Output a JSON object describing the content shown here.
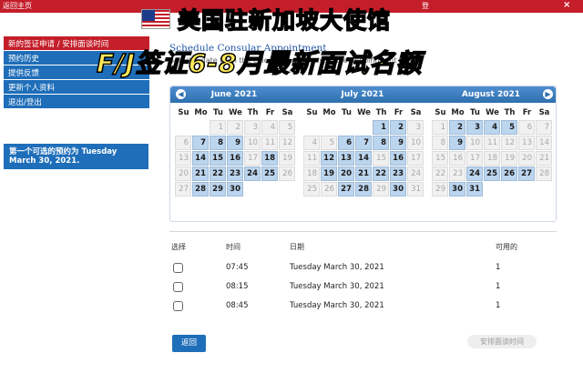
{
  "topbar": {
    "back_label": "返回主页",
    "right_text": "登",
    "close_glyph": "×"
  },
  "sidebar": {
    "items": [
      {
        "label": "新的签证申请 / 安排面谈时间"
      },
      {
        "label": "预约历史"
      },
      {
        "label": "提供反馈"
      },
      {
        "label": "更新个人资料"
      },
      {
        "label": "退出/登出"
      }
    ],
    "next_appointment_line1": "第一个可选的预约为 Tuesday",
    "next_appointment_line2": "March 30, 2021."
  },
  "page": {
    "title": "Schedule Consular Appointment",
    "subtitle": "Select a date from the calendar and an available appointment time."
  },
  "calendar": {
    "prev_glyph": "◀",
    "next_glyph": "▶",
    "weekdays": [
      "Su",
      "Mo",
      "Tu",
      "We",
      "Th",
      "Fr",
      "Sa"
    ],
    "months": [
      {
        "name": "June 2021",
        "weeks": [
          [
            "",
            "",
            "1",
            "2",
            "3",
            "4",
            "5"
          ],
          [
            "6",
            "7",
            "8",
            "9",
            "10",
            "11",
            "12"
          ],
          [
            "13",
            "14",
            "15",
            "16",
            "17",
            "18",
            "19"
          ],
          [
            "20",
            "21",
            "22",
            "23",
            "24",
            "25",
            "26"
          ],
          [
            "27",
            "28",
            "29",
            "30",
            "",
            "",
            ""
          ]
        ],
        "available": [
          "7",
          "8",
          "9",
          "14",
          "15",
          "16",
          "18",
          "21",
          "22",
          "23",
          "24",
          "25",
          "28",
          "29",
          "30"
        ]
      },
      {
        "name": "July 2021",
        "weeks": [
          [
            "",
            "",
            "",
            "",
            "1",
            "2",
            "3"
          ],
          [
            "4",
            "5",
            "6",
            "7",
            "8",
            "9",
            "10"
          ],
          [
            "11",
            "12",
            "13",
            "14",
            "15",
            "16",
            "17"
          ],
          [
            "18",
            "19",
            "20",
            "21",
            "22",
            "23",
            "24"
          ],
          [
            "25",
            "26",
            "27",
            "28",
            "29",
            "30",
            "31"
          ]
        ],
        "available": [
          "1",
          "2",
          "6",
          "7",
          "8",
          "9",
          "12",
          "13",
          "14",
          "16",
          "19",
          "20",
          "21",
          "22",
          "23",
          "27",
          "28",
          "30"
        ]
      },
      {
        "name": "August 2021",
        "weeks": [
          [
            "1",
            "2",
            "3",
            "4",
            "5",
            "6",
            "7"
          ],
          [
            "8",
            "9",
            "10",
            "11",
            "12",
            "13",
            "14"
          ],
          [
            "15",
            "16",
            "17",
            "18",
            "19",
            "20",
            "21"
          ],
          [
            "22",
            "23",
            "24",
            "25",
            "26",
            "27",
            "28"
          ],
          [
            "29",
            "30",
            "31",
            "",
            "",
            "",
            ""
          ]
        ],
        "available": [
          "2",
          "3",
          "4",
          "5",
          "9",
          "24",
          "25",
          "26",
          "27",
          "30",
          "31"
        ]
      }
    ]
  },
  "slots": {
    "headers": {
      "select": "选择",
      "time": "时间",
      "date": "日期",
      "available": "可用的"
    },
    "rows": [
      {
        "time": "07:45",
        "date": "Tuesday March 30, 2021",
        "available": "1"
      },
      {
        "time": "08:15",
        "date": "Tuesday March 30, 2021",
        "available": "1"
      },
      {
        "time": "08:45",
        "date": "Tuesday March 30, 2021",
        "available": "1"
      }
    ]
  },
  "buttons": {
    "back": "返回",
    "schedule": "安排面谈时间"
  },
  "overlay": {
    "headline1": "美国驻新加坡大使馆",
    "headline2": "F/J签证6-8月最新面试名额"
  },
  "colors": {
    "brand_red": "#c41e2a",
    "brand_blue": "#1f6eb9",
    "available_day": "#bcd5ee",
    "overlay_text": "#ffe85a"
  }
}
